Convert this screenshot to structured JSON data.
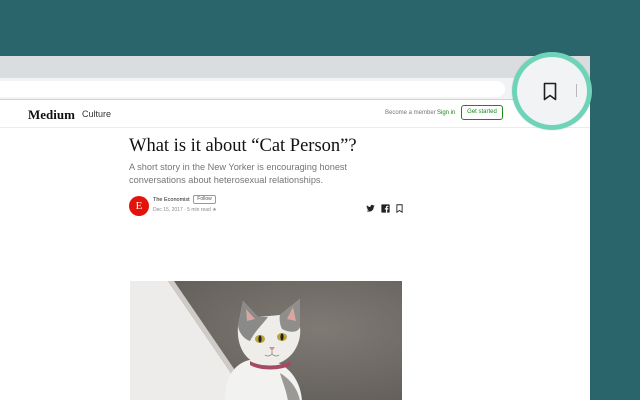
{
  "nav": {
    "logo": "Medium",
    "section": "Culture",
    "become_member": "Become a member",
    "sign_in": "Sign in",
    "get_started": "Get started"
  },
  "article": {
    "title": "What is it about “Cat Person”?",
    "subtitle": "A short story in the New Yorker is encouraging honest conversations about heterosexual relationships.",
    "avatar_letter": "E",
    "author": "The Economist",
    "follow_label": "Follow",
    "meta": "Dec 15, 2017 · 5 min read ★"
  },
  "icons": {
    "toolbar_bookmark": "bookmark-icon",
    "share": [
      "twitter-icon",
      "facebook-icon",
      "bookmark-icon"
    ]
  },
  "colors": {
    "background": "#29656b",
    "highlight_ring": "#6fd3b8",
    "brand_green": "#1a8917",
    "avatar_red": "#e3120b"
  }
}
